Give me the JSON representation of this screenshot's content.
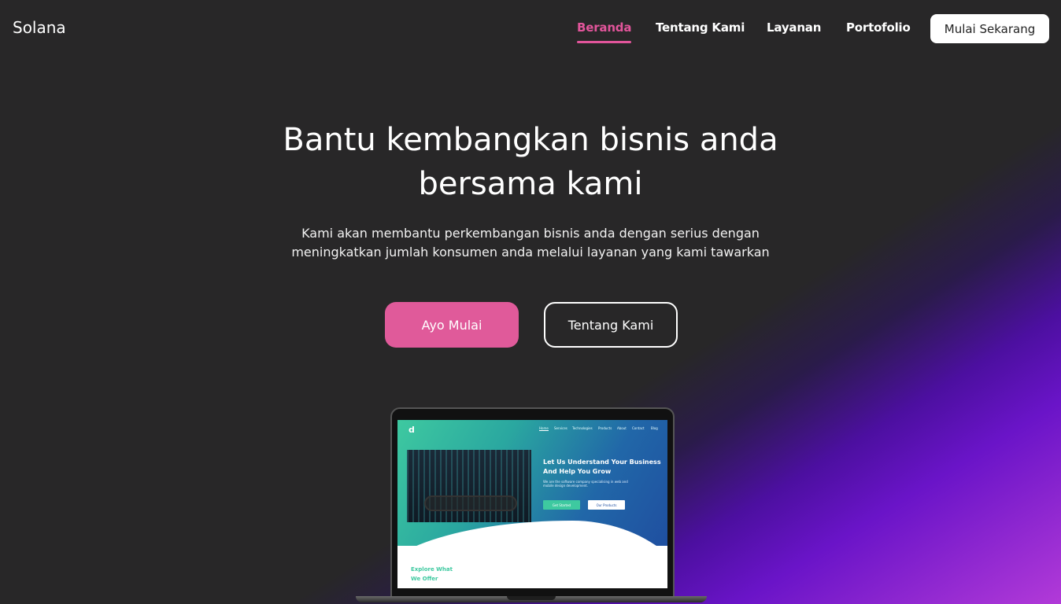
{
  "brand": "Solana",
  "nav": {
    "links": [
      {
        "label": "Beranda",
        "active": true
      },
      {
        "label": "Tentang Kami",
        "active": false
      },
      {
        "label": "Layanan",
        "active": false
      },
      {
        "label": "Portofolio",
        "active": false
      }
    ],
    "cta": "Mulai Sekarang"
  },
  "hero": {
    "title_line1": "Bantu kembangkan bisnis anda",
    "title_line2": "bersama kami",
    "subtitle_line1": "Kami akan membantu perkembangan bisnis anda dengan serius dengan",
    "subtitle_line2": "meningkatkan jumlah konsumen anda melalui layanan yang kami tawarkan",
    "primary_button": "Ayo Mulai",
    "secondary_button": "Tentang Kami"
  },
  "mockup": {
    "logo": "d",
    "nav": [
      "Home",
      "Services",
      "Technologies",
      "Products",
      "About",
      "Contact",
      "Blog"
    ],
    "heading_line1": "Let Us Understand Your Business",
    "heading_line2": "And Help You Grow",
    "description": "We are the software company specialising in web and mobile design development.",
    "button_primary": "Get Started",
    "button_secondary": "Our Products",
    "explore_line1": "Explore What",
    "explore_line2": "We Offer"
  },
  "colors": {
    "background": "#282728",
    "accent_pink": "#e05a9a",
    "gradient_purple": "#6a14c8",
    "gradient_magenta": "#b23ad8"
  }
}
